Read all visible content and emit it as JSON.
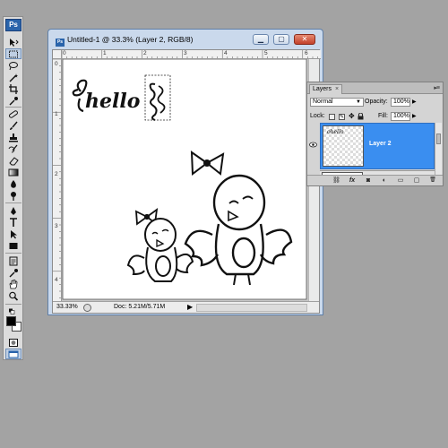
{
  "app": {
    "logo": "Ps"
  },
  "tools": [
    "move-tool-icon",
    "marquee-tool-icon",
    "lasso-tool-icon",
    "magic-wand-tool-icon",
    "crop-tool-icon",
    "eyedropper-tool-icon",
    "healing-brush-tool-icon",
    "brush-tool-icon",
    "clone-stamp-tool-icon",
    "history-brush-tool-icon",
    "eraser-tool-icon",
    "gradient-tool-icon",
    "blur-tool-icon",
    "dodge-tool-icon",
    "pen-tool-icon",
    "type-tool-icon",
    "path-selection-tool-icon",
    "rectangle-tool-icon",
    "notes-tool-icon",
    "hand-tool-icon",
    "zoom-tool-icon"
  ],
  "document": {
    "title": "Untitled-1 @ 33.3% (Layer 2, RGB/8)",
    "title_badge": "Ps",
    "buttons": {
      "minimize": "▁",
      "maximize": "▢",
      "close": "✕"
    },
    "ruler_top": [
      "0",
      "1",
      "2",
      "3",
      "4",
      "5",
      "6"
    ],
    "ruler_left": [
      "0",
      "1",
      "2",
      "3",
      "4"
    ],
    "canvas_text": "hello",
    "status": {
      "zoom": "33.33%",
      "doc_info": "Doc: 5.21M/5.71M",
      "arrow": "▶"
    }
  },
  "layers_panel": {
    "tab": "Layers",
    "tab_close": "×",
    "menu": "▸≡",
    "blend_mode": "Normal",
    "opacity_label": "Opacity:",
    "opacity_value": "100%",
    "lock_label": "Lock:",
    "fill_label": "Fill:",
    "fill_value": "100%",
    "selected_layer": {
      "name": "Layer 2",
      "thumb_text": "ohello"
    },
    "footer_icons": [
      "link-icon",
      "fx-icon",
      "mask-icon",
      "adjustment-icon",
      "folder-icon",
      "new-layer-icon",
      "trash-icon"
    ],
    "footer_labels": [
      "⛓",
      "fx",
      "◙",
      "◐",
      "▭",
      "▢",
      "🗑"
    ]
  },
  "colors": {
    "workspace": "#a3a3a3",
    "selection_blue": "#3a8ef0",
    "window_frame": "#cad9ec"
  }
}
